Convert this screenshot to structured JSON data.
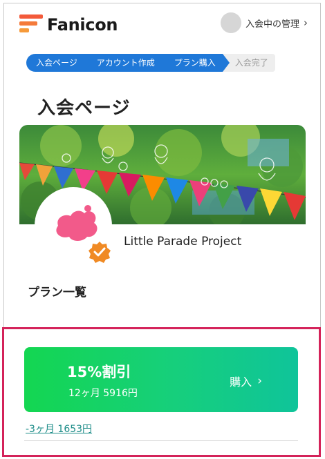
{
  "brand": {
    "name": "Fanicon"
  },
  "header": {
    "member_label": "入会中の管理",
    "chevron": "›"
  },
  "stepper": {
    "steps": [
      {
        "label": "入会ページ",
        "state": "active"
      },
      {
        "label": "アカウント作成",
        "state": "active"
      },
      {
        "label": "プラン購入",
        "state": "active"
      },
      {
        "label": "入会完了",
        "state": "pending"
      }
    ]
  },
  "page": {
    "title": "入会ページ"
  },
  "community": {
    "name": "Little Parade Project",
    "verified_icon": "check-badge-icon",
    "avatar_icon": "pink-blob-icon"
  },
  "plans": {
    "section_label": "プラン一覧",
    "featured": {
      "title": "15%割引",
      "price": "12ヶ月 5916円",
      "buy_label": "購入",
      "buy_chevron": "›"
    },
    "alternate": {
      "label": "-3ヶ月 1653円"
    }
  },
  "colors": {
    "accent_blue": "#1f78d8",
    "plan_green_start": "#14d651",
    "plan_green_end": "#0fc49a",
    "highlight": "#d4235a",
    "badge_orange": "#f08a24",
    "link_teal": "#1c8c88"
  }
}
